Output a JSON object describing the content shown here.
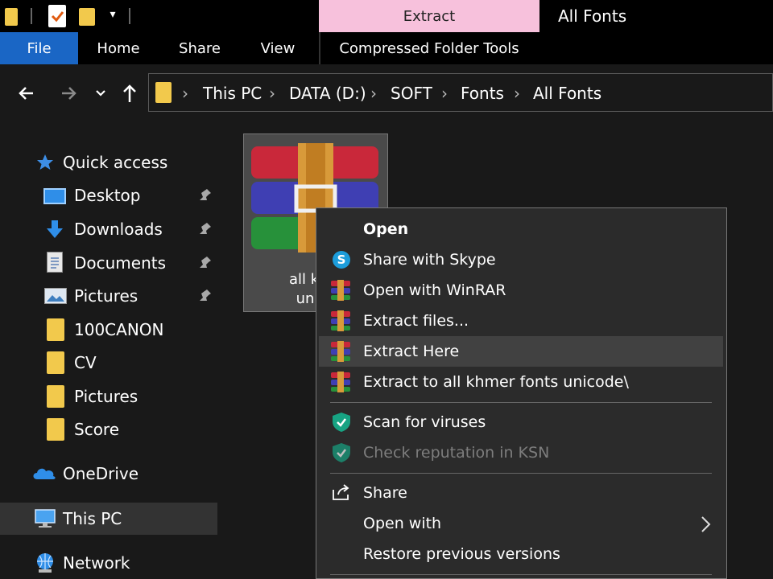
{
  "window": {
    "title": "All Fonts",
    "context_tab": "Extract",
    "context_tab_color": "#f7c1dc"
  },
  "ribbon": {
    "tabs": [
      {
        "label": "File"
      },
      {
        "label": "Home"
      },
      {
        "label": "Share"
      },
      {
        "label": "View"
      },
      {
        "label": "Compressed Folder Tools"
      }
    ]
  },
  "nav": {
    "back_icon": "arrow-left-icon",
    "forward_icon": "arrow-right-icon",
    "recent_icon": "chevron-down-icon",
    "up_icon": "arrow-up-icon",
    "breadcrumb": [
      "This PC",
      "DATA (D:)",
      "SOFT",
      "Fonts",
      "All Fonts"
    ]
  },
  "sidebar": {
    "items": [
      {
        "label": "Quick access",
        "icon": "star-icon",
        "pinned": false
      },
      {
        "label": "Desktop",
        "icon": "desktop-icon",
        "pinned": true
      },
      {
        "label": "Downloads",
        "icon": "download-icon",
        "pinned": true
      },
      {
        "label": "Documents",
        "icon": "document-icon",
        "pinned": true
      },
      {
        "label": "Pictures",
        "icon": "pictures-icon",
        "pinned": true
      },
      {
        "label": "100CANON",
        "icon": "folder-icon",
        "pinned": false
      },
      {
        "label": "CV",
        "icon": "folder-icon",
        "pinned": false
      },
      {
        "label": "Pictures",
        "icon": "folder-icon",
        "pinned": false
      },
      {
        "label": "Score",
        "icon": "folder-icon",
        "pinned": false
      },
      {
        "label": "OneDrive",
        "icon": "cloud-icon",
        "pinned": false
      },
      {
        "label": "This PC",
        "icon": "computer-icon",
        "pinned": false,
        "selected": true
      },
      {
        "label": "Network",
        "icon": "network-icon",
        "pinned": false
      }
    ]
  },
  "file": {
    "label_line1": "all khm",
    "label_line2": "unico"
  },
  "context_menu": {
    "items": [
      {
        "label": "Open",
        "bold": true
      },
      {
        "label": "Share with Skype",
        "icon": "skype-icon"
      },
      {
        "label": "Open with WinRAR",
        "icon": "winrar-icon"
      },
      {
        "label": "Extract files...",
        "icon": "winrar-icon"
      },
      {
        "label": "Extract Here",
        "icon": "winrar-icon",
        "hover": true
      },
      {
        "label": "Extract to all khmer fonts unicode\\",
        "icon": "winrar-icon"
      },
      {
        "label": "Scan for viruses",
        "icon": "kaspersky-shield-icon"
      },
      {
        "label": "Check reputation in KSN",
        "icon": "kaspersky-shield-icon",
        "disabled": true
      },
      {
        "label": "Share",
        "icon": "share-icon"
      },
      {
        "label": "Open with",
        "submenu": true
      },
      {
        "label": "Restore previous versions"
      }
    ]
  }
}
